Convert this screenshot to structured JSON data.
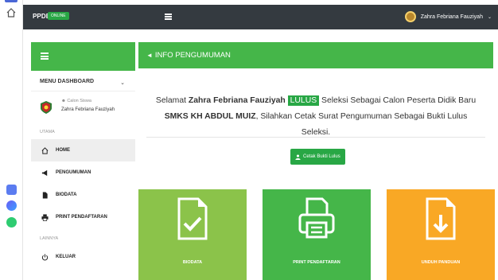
{
  "topbar": {
    "brand": "PPDB",
    "status_badge": "ONLINE",
    "user_name": "Zahra Febriana Fauziyah"
  },
  "sidebar": {
    "menu_title": "MENU DASHBOARD",
    "profile_role": "Calon Siswa",
    "profile_name": "Zahra Febriana Fauziyah",
    "section_utama": "UTAMA",
    "section_lainnya": "LAINNYA",
    "items": [
      {
        "label": "HOME",
        "icon": "home-icon",
        "active": true
      },
      {
        "label": "PENGUMUMAN",
        "icon": "megaphone-icon",
        "active": false
      },
      {
        "label": "BIODATA",
        "icon": "file-icon",
        "active": false
      },
      {
        "label": "PRINT PENDAFTARAN",
        "icon": "printer-icon",
        "active": false
      },
      {
        "label": "KELUAR",
        "icon": "power-icon",
        "active": false
      }
    ]
  },
  "info_card": {
    "title": "INFO PENGUMUMAN",
    "text_1": "Selamat",
    "name": "Zahra Febriana Fauziyah",
    "status": "LULUS",
    "text_2": "Seleksi Sebagai Calon Peserta Didik Baru",
    "school": "SMKS KH ABDUL MUIZ",
    "text_3": ", Silahkan Cetak Surat Pengumuman Sebagai Bukti Lulus Seleksi.",
    "button_label": "Cetak Bukti Lulus"
  },
  "tiles": [
    {
      "label": "BIODATA",
      "color": "#8bc34a"
    },
    {
      "label": "PRINT PENDAFTARAN",
      "color": "#45b649"
    },
    {
      "label": "UNDUH PANDUAN",
      "color": "#f9a825"
    }
  ],
  "colors": {
    "accent": "#45b649",
    "dark": "#343a40",
    "success": "#28a745"
  }
}
